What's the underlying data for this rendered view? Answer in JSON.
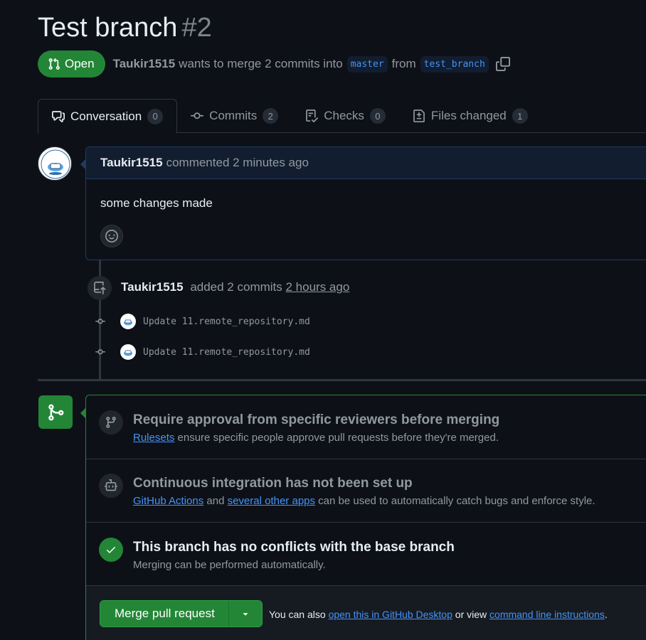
{
  "pr": {
    "title": "Test branch",
    "number": "#2",
    "state": "Open",
    "author": "Taukir1515",
    "merge_text": "wants to merge 2 commits into",
    "base_branch": "master",
    "from_text": "from",
    "head_branch": "test_branch"
  },
  "tabs": [
    {
      "label": "Conversation",
      "count": "0",
      "icon": "comment-discussion-icon"
    },
    {
      "label": "Commits",
      "count": "2",
      "icon": "git-commit-icon"
    },
    {
      "label": "Checks",
      "count": "0",
      "icon": "checklist-icon"
    },
    {
      "label": "Files changed",
      "count": "1",
      "icon": "file-diff-icon"
    }
  ],
  "comment": {
    "author": "Taukir1515",
    "action": "commented 2 minutes ago",
    "body": "some changes made"
  },
  "commits_event": {
    "author": "Taukir1515",
    "action": "added 2 commits",
    "time": "2 hours ago",
    "commits": [
      {
        "message": "Update 11.remote_repository.md"
      },
      {
        "message": "Update 11.remote_repository.md"
      }
    ]
  },
  "merge_box": {
    "reviewers": {
      "title": "Require approval from specific reviewers before merging",
      "link": "Rulesets",
      "desc": "ensure specific people approve pull requests before they're merged."
    },
    "ci": {
      "title": "Continuous integration has not been set up",
      "link1": "GitHub Actions",
      "and": "and",
      "link2": "several other apps",
      "desc": "can be used to automatically catch bugs and enforce style."
    },
    "conflicts": {
      "title": "This branch has no conflicts with the base branch",
      "desc": "Merging can be performed automatically."
    },
    "merge_button": "Merge pull request",
    "note_prefix": "You can also",
    "note_link1": "open this in GitHub Desktop",
    "note_mid": "or view",
    "note_link2": "command line instructions",
    "note_suffix": "."
  },
  "colors": {
    "background": "#0d1117",
    "success": "#238636",
    "link": "#4493f8",
    "muted": "#9198a1"
  }
}
